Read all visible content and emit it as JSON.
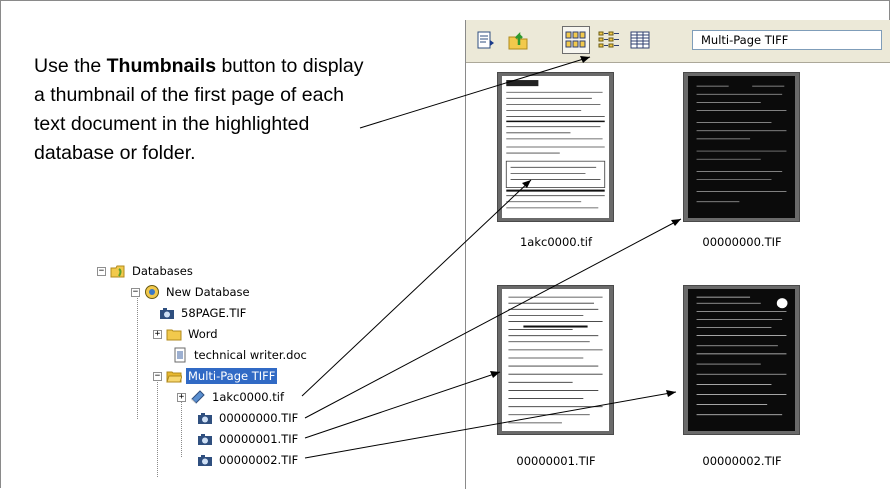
{
  "caption": {
    "before": "Use the ",
    "bold": "Thumbnails",
    "after": " button to display a thumbnail of the first page of each text document in the highlighted database or folder."
  },
  "tree": {
    "items": [
      {
        "label": "Databases",
        "icon": "databases-icon",
        "expander": "minus"
      },
      {
        "label": "New Database",
        "icon": "database-icon",
        "expander": "minus"
      },
      {
        "label": "58PAGE.TIF",
        "icon": "camera-icon",
        "expander": ""
      },
      {
        "label": "Word",
        "icon": "folder-icon",
        "expander": "plus"
      },
      {
        "label": "technical writer.doc",
        "icon": "document-icon",
        "expander": ""
      },
      {
        "label": "Multi-Page TIFF",
        "icon": "folder-open-icon",
        "expander": "minus",
        "selected": true
      },
      {
        "label": "1akc0000.tif",
        "icon": "book-icon",
        "expander": "plus"
      },
      {
        "label": "00000000.TIF",
        "icon": "camera-icon",
        "expander": ""
      },
      {
        "label": "00000001.TIF",
        "icon": "camera-icon",
        "expander": ""
      },
      {
        "label": "00000002.TIF",
        "icon": "camera-icon",
        "expander": ""
      }
    ]
  },
  "toolbar": {
    "buttons": [
      "properties-icon",
      "up-folder-icon",
      "thumbnails-icon",
      "list-view-icon",
      "details-view-icon"
    ],
    "active": "thumbnails-icon",
    "folder_title": "Multi-Page TIFF"
  },
  "thumbnails": [
    {
      "label": "1akc0000.tif",
      "style": "light"
    },
    {
      "label": "00000000.TIF",
      "style": "dark"
    },
    {
      "label": "00000001.TIF",
      "style": "light"
    },
    {
      "label": "00000002.TIF",
      "style": "dark"
    }
  ],
  "colors": {
    "selection": "#316ac5",
    "toolbar_bg": "#ece9d8",
    "folder": "#f2c94c"
  }
}
